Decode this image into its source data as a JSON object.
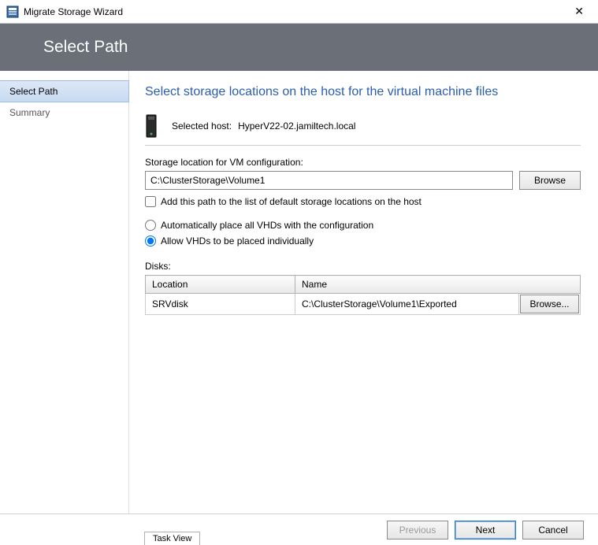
{
  "titlebar": {
    "title": "Migrate Storage Wizard"
  },
  "header": {
    "title": "Select Path"
  },
  "sidebar": {
    "items": [
      {
        "label": "Select Path",
        "active": true
      },
      {
        "label": "Summary",
        "active": false
      }
    ]
  },
  "content": {
    "title": "Select storage locations on the host for the virtual machine files",
    "host_label": "Selected host:",
    "host_value": "HyperV22-02.jamiltech.local",
    "storage_label": "Storage location for VM configuration:",
    "storage_path": "C:\\ClusterStorage\\Volume1",
    "browse_label": "Browse",
    "add_path_label": "Add this path to the list of default storage locations on the host",
    "radio_auto_label": "Automatically place all VHDs with the configuration",
    "radio_indiv_label": "Allow VHDs to be placed individually",
    "disks_label": "Disks:",
    "table": {
      "headers": {
        "location": "Location",
        "name": "Name"
      },
      "rows": [
        {
          "location": "SRVdisk",
          "name": "C:\\ClusterStorage\\Volume1\\Exported"
        }
      ],
      "browse_label": "Browse..."
    }
  },
  "footer": {
    "previous": "Previous",
    "next": "Next",
    "cancel": "Cancel"
  },
  "task_view": "Task View"
}
